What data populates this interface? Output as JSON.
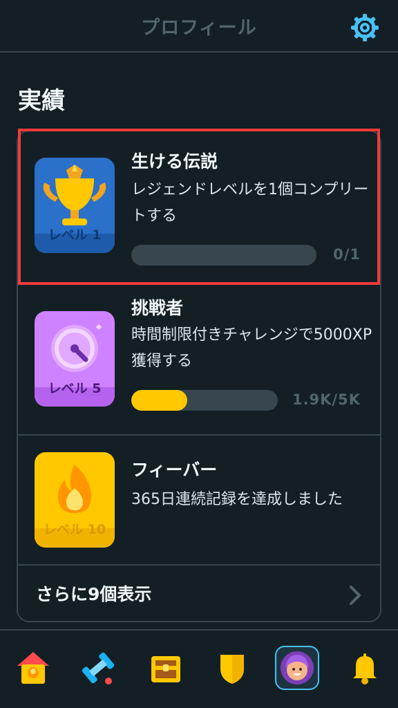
{
  "header": {
    "title": "プロフィール",
    "settings_icon": "gear-icon"
  },
  "section": {
    "title": "実績"
  },
  "achievements": [
    {
      "badge_label": "レベル 1",
      "title": "生ける伝説",
      "description": "レジェンドレベルを1個コンプリートする",
      "progress": 0.0,
      "count": "0/1",
      "icon": "trophy-icon",
      "color": "#2b70c9"
    },
    {
      "badge_label": "レベル 5",
      "title": "挑戦者",
      "description": "時間制限付きチャレンジで5000XP獲得する",
      "progress": 0.38,
      "count": "1.9K/5K",
      "icon": "stopwatch-icon",
      "color": "#ce82ff"
    },
    {
      "badge_label": "レベル 10",
      "title": "フィーバー",
      "description": "365日連続記録を達成しました",
      "icon": "flame-icon",
      "color": "#ffc800"
    }
  ],
  "more": {
    "label": "さらに9個表示"
  },
  "tabs": [
    {
      "name": "home",
      "icon": "home-icon"
    },
    {
      "name": "practice",
      "icon": "dumbbell-icon"
    },
    {
      "name": "shop",
      "icon": "treasure-chest-icon"
    },
    {
      "name": "leagues",
      "icon": "shield-icon"
    },
    {
      "name": "profile",
      "icon": "avatar-icon",
      "active": true
    },
    {
      "name": "notifications",
      "icon": "bell-icon"
    }
  ],
  "colors": {
    "background": "#131f24",
    "accent": "#49c0f8",
    "progress": "#ffc800",
    "highlight": "#f23a3a"
  }
}
